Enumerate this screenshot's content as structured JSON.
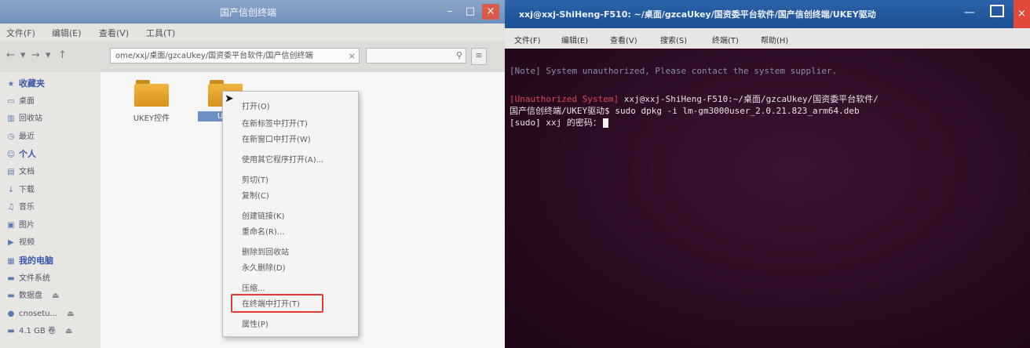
{
  "file_manager": {
    "title": "国产信创终端",
    "menu": [
      "文件(F)",
      "编辑(E)",
      "查看(V)",
      "工具(T)"
    ],
    "path": "ome/xxj/桌面/gzcaUkey/国资委平台软件/国产信创终端",
    "sidebar": [
      {
        "label": "收藏夹",
        "icon": "star-icon",
        "head": true
      },
      {
        "label": "桌面",
        "icon": "desktop-icon"
      },
      {
        "label": "回收站",
        "icon": "trash-icon"
      },
      {
        "label": "最近",
        "icon": "clock-icon"
      },
      {
        "label": "个人",
        "icon": "person-icon",
        "head": true
      },
      {
        "label": "文档",
        "icon": "document-icon"
      },
      {
        "label": "下载",
        "icon": "download-icon"
      },
      {
        "label": "音乐",
        "icon": "music-icon"
      },
      {
        "label": "图片",
        "icon": "image-icon"
      },
      {
        "label": "视频",
        "icon": "video-icon"
      },
      {
        "label": "我的电脑",
        "icon": "computer-icon",
        "head": true
      },
      {
        "label": "文件系统",
        "icon": "drive-icon"
      },
      {
        "label": "数据盘",
        "icon": "drive-icon",
        "eject": true
      },
      {
        "label": "cnosetu...",
        "icon": "disc-icon",
        "eject": true
      },
      {
        "label": "4.1 GB 卷",
        "icon": "drive-icon",
        "eject": true
      }
    ],
    "folders": [
      {
        "label": "UKEY控件",
        "selected": false
      },
      {
        "label": "UKE",
        "selected": true
      }
    ],
    "context_menu": [
      "打开(O)",
      "在新标签中打开(T)",
      "在新窗口中打开(W)",
      "使用其它程序打开(A)...",
      "剪切(T)",
      "复制(C)",
      "创建链接(K)",
      "重命名(R)...",
      "删除到回收站",
      "永久删除(D)",
      "压缩...",
      "在终端中打开(T)",
      "属性(P)"
    ]
  },
  "terminal": {
    "title": "xxj@xxj-ShiHeng-F510: ~/桌面/gzcaUkey/国资委平台软件/国产信创终端/UKEY驱动",
    "menu": [
      "文件(F)",
      "编辑(E)",
      "查看(V)",
      "搜索(S)",
      "终端(T)",
      "帮助(H)"
    ],
    "note": "[Note] System unauthorized, Please contact the system supplier.",
    "prompt_tag": "[Unauthorized System]",
    "prompt_line1": " xxj@xxj-ShiHeng-F510:~/桌面/gzcaUkey/国资委平台软件/",
    "prompt_line2": "国产信创终端/UKEY驱动$ sudo dpkg -i lm-gm3000user_2.0.21.823_arm64.deb",
    "sudo_line": "[sudo] xxj 的密码："
  },
  "colors": {
    "terminal_bg": "#2b0f23",
    "terminal_title": "#2c63a8",
    "highlight_box": "#e23a30",
    "folder": "#f0b640"
  }
}
